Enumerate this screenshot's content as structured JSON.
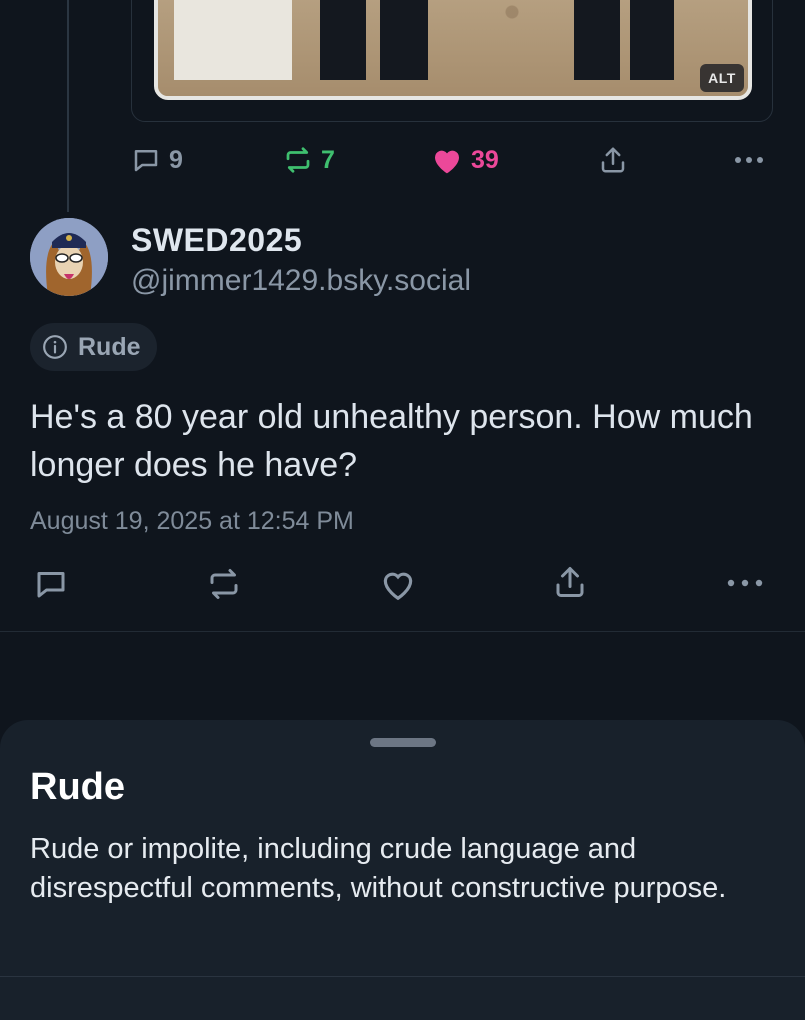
{
  "embed": {
    "alt_badge": "ALT"
  },
  "quoted_post_actions": {
    "reply_count": "9",
    "repost_count": "7",
    "like_count": "39"
  },
  "post": {
    "display_name": "SWED2025",
    "handle": "@jimmer1429.bsky.social",
    "label": "Rude",
    "text": "He's a 80 year old unhealthy person. How much longer does he have?",
    "timestamp": "August 19, 2025 at 12:54 PM"
  },
  "sheet": {
    "title": "Rude",
    "description": "Rude or impolite, including crude language and disrespectful comments, without constructive purpose."
  },
  "colors": {
    "repost_active": "#3fbf6f",
    "like_active": "#ec4899",
    "muted_icon": "#8a97a6",
    "background": "#0f151d"
  },
  "icons": {
    "reply": "speech-bubble-icon",
    "repost": "repost-arrows-icon",
    "like": "heart-icon",
    "share": "share-upload-icon",
    "more": "more-dots-icon",
    "info": "info-circle-icon"
  }
}
